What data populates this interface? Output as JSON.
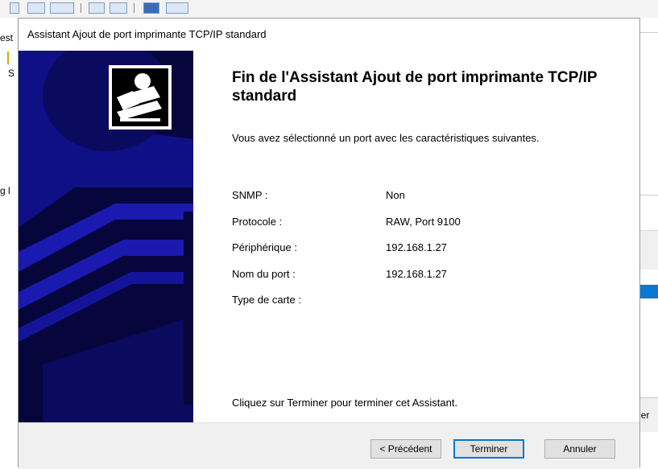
{
  "background": {
    "left_fragments": [
      "est",
      "S",
      "g l"
    ],
    "right_button_fragment": "ler"
  },
  "dialog": {
    "title": "Assistant Ajout de port imprimante TCP/IP standard",
    "heading": "Fin de l'Assistant Ajout de port imprimante TCP/IP standard",
    "intro": "Vous avez sélectionné un port avec les caractéristiques suivantes.",
    "properties": [
      {
        "label": "SNMP :",
        "value": "Non"
      },
      {
        "label": "Protocole :",
        "value": "RAW, Port 9100"
      },
      {
        "label": "Périphérique :",
        "value": "192.168.1.27"
      },
      {
        "label": "Nom du port :",
        "value": "192.168.1.27"
      },
      {
        "label": "Type de carte :",
        "value": ""
      }
    ],
    "finish_text": "Cliquez sur Terminer pour terminer cet Assistant.",
    "buttons": {
      "back": "< Précédent",
      "finish": "Terminer",
      "cancel": "Annuler"
    }
  },
  "colors": {
    "banner_blue": "#0f0f86",
    "banner_dark": "#06063c",
    "default_button_border": "#0078d7"
  },
  "icons": {
    "banner": "printer-port-wizard-icon"
  }
}
